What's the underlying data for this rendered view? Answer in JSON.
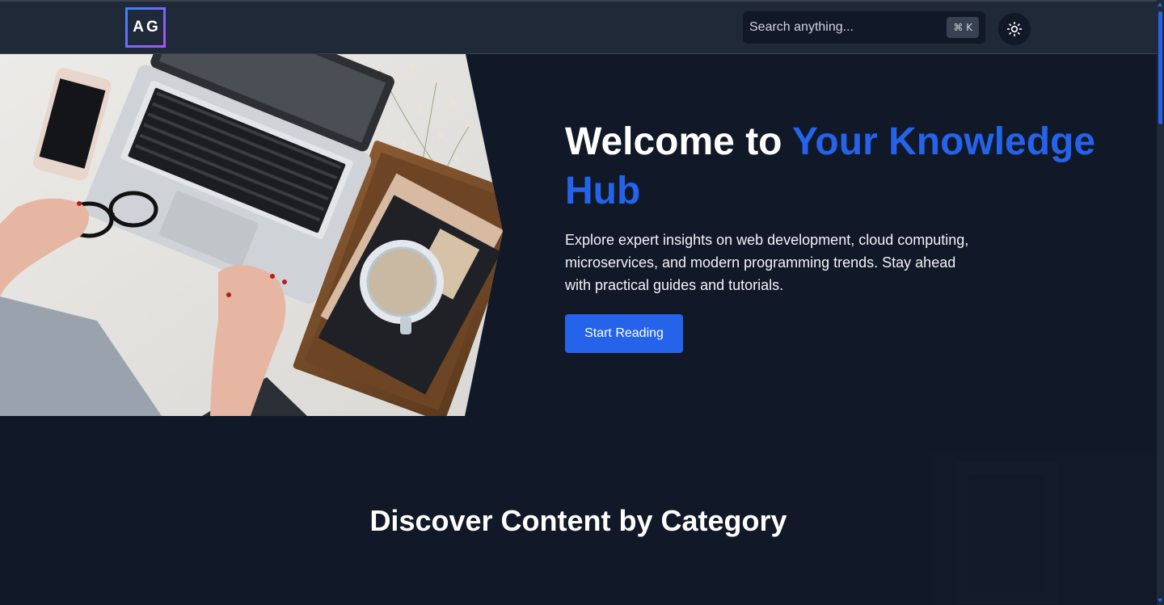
{
  "header": {
    "logo_text": "AG",
    "search_placeholder": "Search anything...",
    "search_shortcut": "⌘ K",
    "theme_toggle_icon": "sun-icon"
  },
  "hero": {
    "title_prefix": "Welcome to ",
    "title_accent": "Your Knowledge Hub",
    "description": "Explore expert insights on web development, cloud computing, microservices, and modern programming trends. Stay ahead with practical guides and tutorials.",
    "cta_label": "Start Reading",
    "image_icon": "laptop-desk-photo"
  },
  "categories": {
    "title": "Discover Content by Category"
  },
  "colors": {
    "background": "#111827",
    "header": "#1f2937",
    "accent": "#2563eb"
  }
}
